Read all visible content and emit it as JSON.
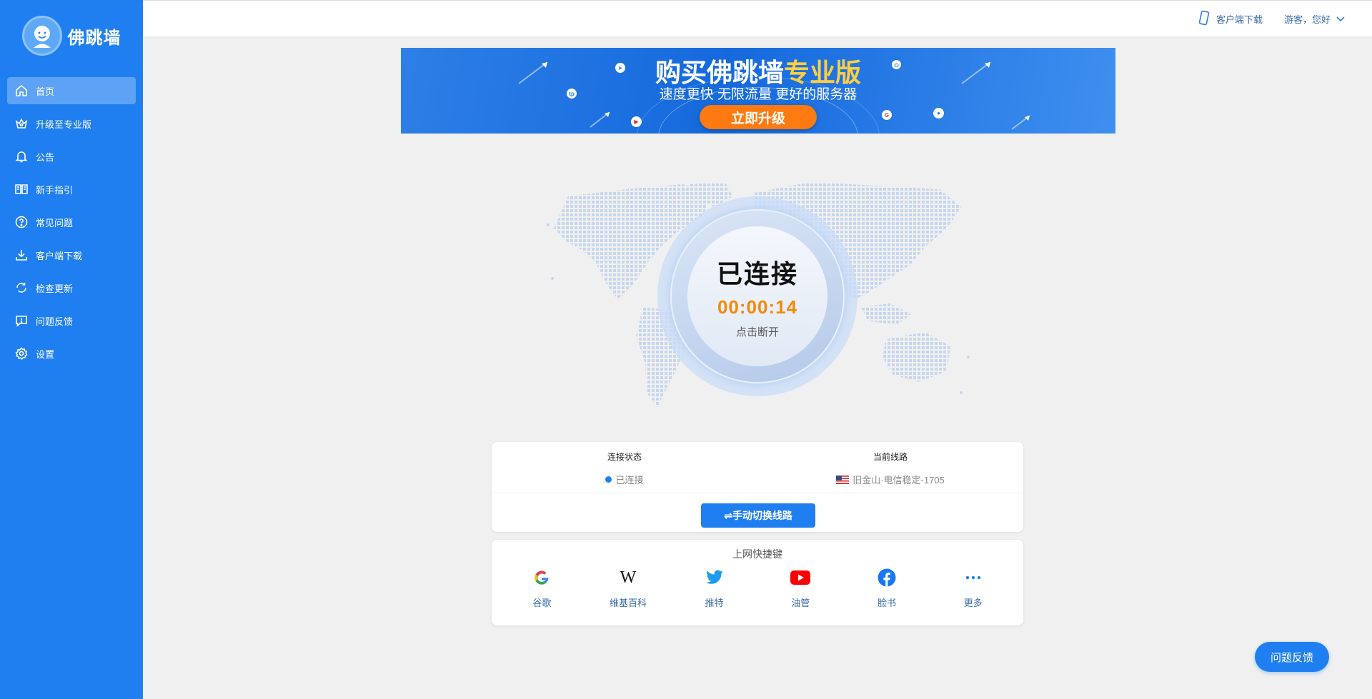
{
  "app": {
    "name": "佛跳墙"
  },
  "sidebar": {
    "items": [
      {
        "label": "首页",
        "icon": "home-icon",
        "active": true
      },
      {
        "label": "升级至专业版",
        "icon": "crown-icon"
      },
      {
        "label": "公告",
        "icon": "bell-icon"
      },
      {
        "label": "新手指引",
        "icon": "book-icon"
      },
      {
        "label": "常见问题",
        "icon": "question-icon"
      },
      {
        "label": "客户端下载",
        "icon": "download-icon"
      },
      {
        "label": "检查更新",
        "icon": "refresh-icon"
      },
      {
        "label": "问题反馈",
        "icon": "feedback-icon"
      },
      {
        "label": "设置",
        "icon": "gear-icon"
      }
    ]
  },
  "header": {
    "download_label": "客户端下载",
    "user_label": "游客，您好"
  },
  "banner": {
    "title_prefix": "购买佛跳墙",
    "title_highlight": "专业版",
    "subtitle": "速度更快 无限流量 更好的服务器",
    "button": "立即升级"
  },
  "connection": {
    "status_title": "已连接",
    "timer": "00:00:14",
    "action": "点击断开"
  },
  "status": {
    "state_label": "连接状态",
    "state_value": "已连接",
    "route_label": "当前线路",
    "route_value": "旧金山·电信稳定-1705",
    "switch_button": "⇌手动切换线路"
  },
  "shortcuts": {
    "title": "上网快捷键",
    "items": [
      {
        "label": "谷歌",
        "icon": "google-icon"
      },
      {
        "label": "维基百科",
        "icon": "wikipedia-icon"
      },
      {
        "label": "推特",
        "icon": "twitter-icon"
      },
      {
        "label": "油管",
        "icon": "youtube-icon"
      },
      {
        "label": "脸书",
        "icon": "facebook-icon"
      },
      {
        "label": "更多",
        "icon": "more-icon"
      }
    ]
  },
  "feedback_button": "问题反馈",
  "colors": {
    "primary": "#1f7ff0",
    "accent_orange": "#f28a07",
    "banner_button": "#ff7a10",
    "banner_highlight": "#ffcf3f"
  }
}
